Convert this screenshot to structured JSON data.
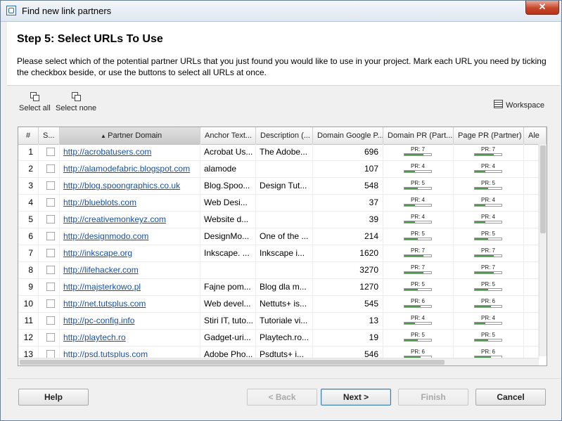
{
  "window": {
    "title": "Find new link partners",
    "close_label": "✕"
  },
  "header": {
    "title": "Step 5: Select URLs To Use",
    "description": "Please select which of the potential partner URLs that you just found you would like to use in your project. Mark each URL you need by ticking the checkbox beside, or use the buttons to select all URLs at once."
  },
  "toolbar": {
    "select_all": "Select all",
    "select_none": "Select none",
    "workspace": "Workspace"
  },
  "columns": [
    "#",
    "S...",
    "Partner Domain",
    "Anchor Text...",
    "Description (...",
    "Domain Google P...",
    "Domain PR (Part...",
    "Page PR (Partner)",
    "Ale"
  ],
  "rows": [
    {
      "n": "1",
      "domain": "http://acrobatusers.com",
      "anchor": "Acrobat Us...",
      "desc": "The Adobe...",
      "gpr": "696",
      "dpr": "PR: 7",
      "dpr_v": 7,
      "ppr": "PR: 7",
      "ppr_v": 7
    },
    {
      "n": "2",
      "domain": "http://alamodefabric.blogspot.com",
      "anchor": "alamode",
      "desc": "",
      "gpr": "107",
      "dpr": "PR: 4",
      "dpr_v": 4,
      "ppr": "PR: 4",
      "ppr_v": 4
    },
    {
      "n": "3",
      "domain": "http://blog.spoongraphics.co.uk",
      "anchor": "Blog.Spoo...",
      "desc": "Design Tut...",
      "gpr": "548",
      "dpr": "PR: 5",
      "dpr_v": 5,
      "ppr": "PR: 5",
      "ppr_v": 5
    },
    {
      "n": "4",
      "domain": "http://blueblots.com",
      "anchor": "Web Desi...",
      "desc": "",
      "gpr": "37",
      "dpr": "PR: 4",
      "dpr_v": 4,
      "ppr": "PR: 4",
      "ppr_v": 4
    },
    {
      "n": "5",
      "domain": "http://creativemonkeyz.com",
      "anchor": "Website d...",
      "desc": "",
      "gpr": "39",
      "dpr": "PR: 4",
      "dpr_v": 4,
      "ppr": "PR: 4",
      "ppr_v": 4
    },
    {
      "n": "6",
      "domain": "http://designmodo.com",
      "anchor": "DesignMo...",
      "desc": "One of the ...",
      "gpr": "214",
      "dpr": "PR: 5",
      "dpr_v": 5,
      "ppr": "PR: 5",
      "ppr_v": 5
    },
    {
      "n": "7",
      "domain": "http://inkscape.org",
      "anchor": "Inkscape. ...",
      "desc": "Inkscape i...",
      "gpr": "1620",
      "dpr": "PR: 7",
      "dpr_v": 7,
      "ppr": "PR: 7",
      "ppr_v": 7
    },
    {
      "n": "8",
      "domain": "http://lifehacker.com",
      "anchor": "",
      "desc": "",
      "gpr": "3270",
      "dpr": "PR: 7",
      "dpr_v": 7,
      "ppr": "PR: 7",
      "ppr_v": 7
    },
    {
      "n": "9",
      "domain": "http://majsterkowo.pl",
      "anchor": "Fajne pom...",
      "desc": "Blog dla m...",
      "gpr": "1270",
      "dpr": "PR: 5",
      "dpr_v": 5,
      "ppr": "PR: 5",
      "ppr_v": 5
    },
    {
      "n": "10",
      "domain": "http://net.tutsplus.com",
      "anchor": "Web devel...",
      "desc": "Nettuts+ is...",
      "gpr": "545",
      "dpr": "PR: 6",
      "dpr_v": 6,
      "ppr": "PR: 6",
      "ppr_v": 6
    },
    {
      "n": "11",
      "domain": "http://pc-config.info",
      "anchor": "Stiri IT, tuto...",
      "desc": "Tutoriale vi...",
      "gpr": "13",
      "dpr": "PR: 4",
      "dpr_v": 4,
      "ppr": "PR: 4",
      "ppr_v": 4
    },
    {
      "n": "12",
      "domain": "http://playtech.ro",
      "anchor": "Gadget-uri...",
      "desc": "Playtech.ro...",
      "gpr": "19",
      "dpr": "PR: 5",
      "dpr_v": 5,
      "ppr": "PR: 5",
      "ppr_v": 5
    },
    {
      "n": "13",
      "domain": "http://psd.tutsplus.com",
      "anchor": "Adobe Pho...",
      "desc": "Psdtuts+ i...",
      "gpr": "546",
      "dpr": "PR: 6",
      "dpr_v": 6,
      "ppr": "PR: 6",
      "ppr_v": 6
    }
  ],
  "footer": {
    "help": "Help",
    "back": "< Back",
    "next": "Next >",
    "finish": "Finish",
    "cancel": "Cancel"
  },
  "colors": {
    "link": "#1a4f9c",
    "pr_fill": "#4a9a4a",
    "default_button_border": "#3c7fb1"
  }
}
